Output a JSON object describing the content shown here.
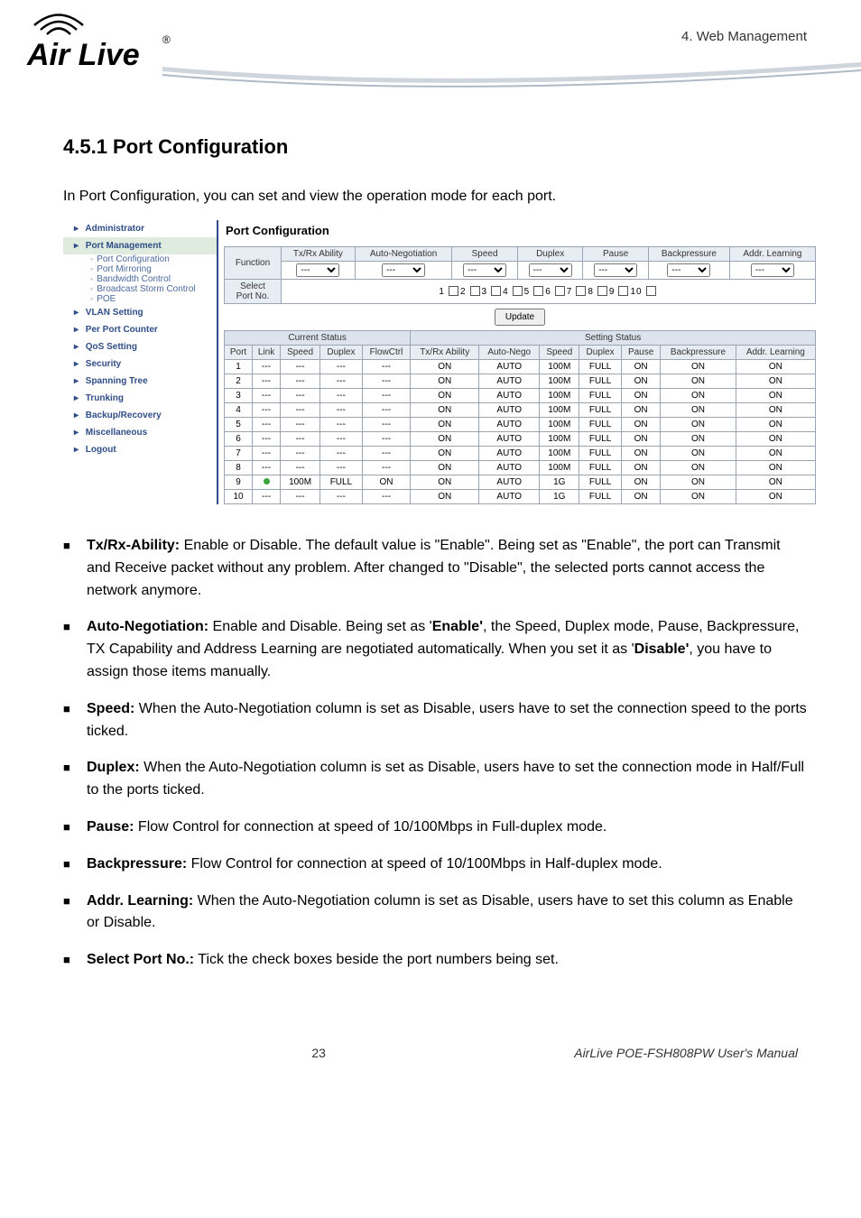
{
  "header": {
    "chapter_label": "4.  Web Management",
    "logo_text_main": "Air Live",
    "logo_reg": "®"
  },
  "section": {
    "number_title": "4.5.1 Port Configuration",
    "intro": "In Port Configuration, you can set and view the operation mode for each port."
  },
  "sidebar": {
    "items": [
      {
        "label": "Administrator",
        "active": false,
        "interactable": true
      },
      {
        "label": "Port Management",
        "active": true,
        "interactable": true
      },
      {
        "label": "VLAN Setting",
        "active": false,
        "interactable": true
      },
      {
        "label": "Per Port Counter",
        "active": false,
        "interactable": true
      },
      {
        "label": "QoS Setting",
        "active": false,
        "interactable": true
      },
      {
        "label": "Security",
        "active": false,
        "interactable": true
      },
      {
        "label": "Spanning Tree",
        "active": false,
        "interactable": true
      },
      {
        "label": "Trunking",
        "active": false,
        "interactable": true
      },
      {
        "label": "Backup/Recovery",
        "active": false,
        "interactable": true
      },
      {
        "label": "Miscellaneous",
        "active": false,
        "interactable": true
      },
      {
        "label": "Logout",
        "active": false,
        "interactable": true
      }
    ],
    "subitems": [
      {
        "label": "Port Configuration"
      },
      {
        "label": "Port Mirroring"
      },
      {
        "label": "Bandwidth Control"
      },
      {
        "label": "Broadcast Storm Control"
      },
      {
        "label": "POE"
      }
    ]
  },
  "panel": {
    "title": "Port Configuration",
    "function_label": "Function",
    "select_port_label": "Select\nPort No.",
    "columns": [
      "Tx/Rx Ability",
      "Auto-Negotiation",
      "Speed",
      "Duplex",
      "Pause",
      "Backpressure",
      "Addr. Learning"
    ],
    "dropdown_value": "---",
    "port_numbers": [
      "1",
      "2",
      "3",
      "4",
      "5",
      "6",
      "7",
      "8",
      "9",
      "10"
    ],
    "update_btn": "Update",
    "current_status_label": "Current Status",
    "setting_status_label": "Setting Status",
    "status_headers_left": [
      "Port",
      "Link",
      "Speed",
      "Duplex",
      "FlowCtrl"
    ],
    "status_headers_right": [
      "Tx/Rx Ability",
      "Auto-Nego",
      "Speed",
      "Duplex",
      "Pause",
      "Backpressure",
      "Addr. Learning"
    ],
    "rows": [
      {
        "port": "1",
        "link": "---",
        "cs_speed": "---",
        "cs_duplex": "---",
        "cs_flow": "---",
        "txrx": "ON",
        "auto": "AUTO",
        "speed": "100M",
        "duplex": "FULL",
        "pause": "ON",
        "bp": "ON",
        "addr": "ON"
      },
      {
        "port": "2",
        "link": "---",
        "cs_speed": "---",
        "cs_duplex": "---",
        "cs_flow": "---",
        "txrx": "ON",
        "auto": "AUTO",
        "speed": "100M",
        "duplex": "FULL",
        "pause": "ON",
        "bp": "ON",
        "addr": "ON"
      },
      {
        "port": "3",
        "link": "---",
        "cs_speed": "---",
        "cs_duplex": "---",
        "cs_flow": "---",
        "txrx": "ON",
        "auto": "AUTO",
        "speed": "100M",
        "duplex": "FULL",
        "pause": "ON",
        "bp": "ON",
        "addr": "ON"
      },
      {
        "port": "4",
        "link": "---",
        "cs_speed": "---",
        "cs_duplex": "---",
        "cs_flow": "---",
        "txrx": "ON",
        "auto": "AUTO",
        "speed": "100M",
        "duplex": "FULL",
        "pause": "ON",
        "bp": "ON",
        "addr": "ON"
      },
      {
        "port": "5",
        "link": "---",
        "cs_speed": "---",
        "cs_duplex": "---",
        "cs_flow": "---",
        "txrx": "ON",
        "auto": "AUTO",
        "speed": "100M",
        "duplex": "FULL",
        "pause": "ON",
        "bp": "ON",
        "addr": "ON"
      },
      {
        "port": "6",
        "link": "---",
        "cs_speed": "---",
        "cs_duplex": "---",
        "cs_flow": "---",
        "txrx": "ON",
        "auto": "AUTO",
        "speed": "100M",
        "duplex": "FULL",
        "pause": "ON",
        "bp": "ON",
        "addr": "ON"
      },
      {
        "port": "7",
        "link": "---",
        "cs_speed": "---",
        "cs_duplex": "---",
        "cs_flow": "---",
        "txrx": "ON",
        "auto": "AUTO",
        "speed": "100M",
        "duplex": "FULL",
        "pause": "ON",
        "bp": "ON",
        "addr": "ON"
      },
      {
        "port": "8",
        "link": "---",
        "cs_speed": "---",
        "cs_duplex": "---",
        "cs_flow": "---",
        "txrx": "ON",
        "auto": "AUTO",
        "speed": "100M",
        "duplex": "FULL",
        "pause": "ON",
        "bp": "ON",
        "addr": "ON"
      },
      {
        "port": "9",
        "link": "●",
        "cs_speed": "100M",
        "cs_duplex": "FULL",
        "cs_flow": "ON",
        "txrx": "ON",
        "auto": "AUTO",
        "speed": "1G",
        "duplex": "FULL",
        "pause": "ON",
        "bp": "ON",
        "addr": "ON"
      },
      {
        "port": "10",
        "link": "---",
        "cs_speed": "---",
        "cs_duplex": "---",
        "cs_flow": "---",
        "txrx": "ON",
        "auto": "AUTO",
        "speed": "1G",
        "duplex": "FULL",
        "pause": "ON",
        "bp": "ON",
        "addr": "ON"
      }
    ]
  },
  "bullets": {
    "txrx_label": "Tx/Rx-Ability:",
    "txrx_text": " Enable or Disable. The default value is \"Enable\". Being set as \"Enable\", the port can Transmit and Receive packet without any problem. After changed to \"Disable\", the selected ports cannot access the network anymore.",
    "auto_label": "Auto-Negotiation:",
    "auto_pre": " Enable and Disable. Being set as '",
    "auto_enable": "Enable'",
    "auto_mid": ", the Speed, Duplex mode, Pause, Backpressure, TX Capability and Address Learning are negotiated automatically. When you set it as '",
    "auto_disable": "Disable'",
    "auto_post": ", you have to assign those items manually.",
    "speed_label": "Speed:",
    "speed_text": " When the Auto-Negotiation column is set as Disable, users have to set the connection speed to the ports ticked.",
    "duplex_label": "Duplex:",
    "duplex_text": " When the Auto-Negotiation column is set as Disable, users have to set the connection mode in Half/Full to the ports ticked.",
    "pause_label": "Pause:",
    "pause_text": " Flow Control for connection at speed of 10/100Mbps in Full-duplex mode.",
    "bp_label": "Backpressure:",
    "bp_text": " Flow Control for connection at speed of 10/100Mbps in Half-duplex mode.",
    "addr_label": "Addr. Learning:",
    "addr_text": " When the Auto-Negotiation column is set as Disable, users have to set this column as Enable or Disable.",
    "select_label": "Select Port No.:",
    "select_text": " Tick the check boxes beside the port numbers being set."
  },
  "footer": {
    "page_no": "23",
    "manual": "AirLive POE-FSH808PW User's Manual"
  }
}
